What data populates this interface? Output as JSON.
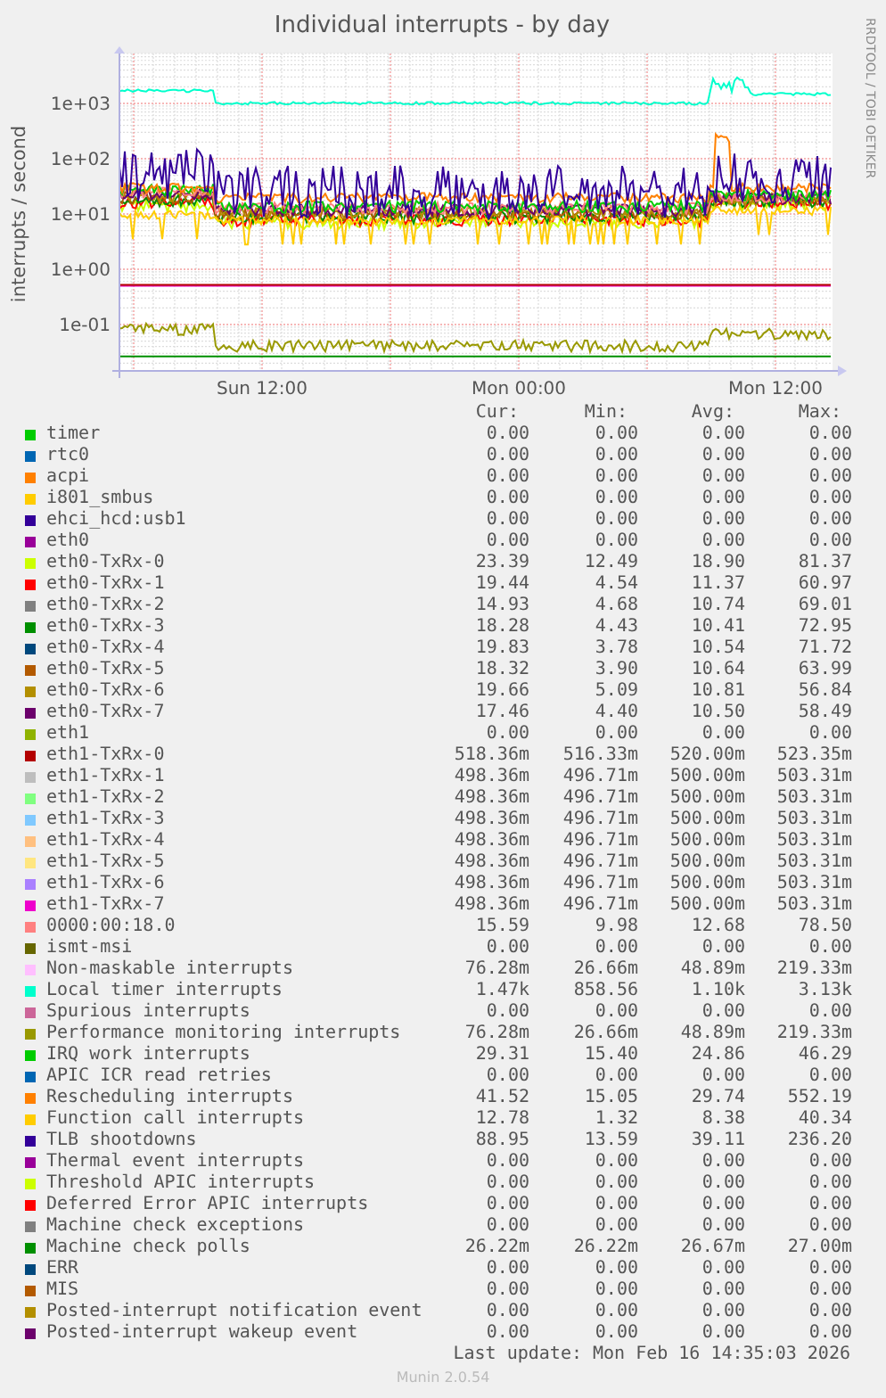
{
  "title": "Individual interrupts - by day",
  "y_axis_label": "interrupts / second",
  "y_ticks": [
    "1e+03",
    "1e+02",
    "1e+01",
    "1e+00",
    "1e-01"
  ],
  "x_ticks": [
    "Sun 12:00",
    "Mon 00:00",
    "Mon 12:00"
  ],
  "credit": "RRDTOOL / TOBI OETIKER",
  "legend": {
    "columns": [
      "Cur:",
      "Min:",
      "Avg:",
      "Max:"
    ],
    "rows": [
      {
        "label": "timer",
        "color": "#00cc00",
        "cur": "0.00",
        "min": "0.00",
        "avg": "0.00",
        "max": "0.00"
      },
      {
        "label": "rtc0",
        "color": "#0066b3",
        "cur": "0.00",
        "min": "0.00",
        "avg": "0.00",
        "max": "0.00"
      },
      {
        "label": "acpi",
        "color": "#ff8000",
        "cur": "0.00",
        "min": "0.00",
        "avg": "0.00",
        "max": "0.00"
      },
      {
        "label": "i801_smbus",
        "color": "#ffcc00",
        "cur": "0.00",
        "min": "0.00",
        "avg": "0.00",
        "max": "0.00"
      },
      {
        "label": "ehci_hcd:usb1",
        "color": "#330099",
        "cur": "0.00",
        "min": "0.00",
        "avg": "0.00",
        "max": "0.00"
      },
      {
        "label": "eth0",
        "color": "#990099",
        "cur": "0.00",
        "min": "0.00",
        "avg": "0.00",
        "max": "0.00"
      },
      {
        "label": "eth0-TxRx-0",
        "color": "#ccff00",
        "cur": "23.39",
        "min": "12.49",
        "avg": "18.90",
        "max": "81.37"
      },
      {
        "label": "eth0-TxRx-1",
        "color": "#ff0000",
        "cur": "19.44",
        "min": "4.54",
        "avg": "11.37",
        "max": "60.97"
      },
      {
        "label": "eth0-TxRx-2",
        "color": "#808080",
        "cur": "14.93",
        "min": "4.68",
        "avg": "10.74",
        "max": "69.01"
      },
      {
        "label": "eth0-TxRx-3",
        "color": "#008f00",
        "cur": "18.28",
        "min": "4.43",
        "avg": "10.41",
        "max": "72.95"
      },
      {
        "label": "eth0-TxRx-4",
        "color": "#00487d",
        "cur": "19.83",
        "min": "3.78",
        "avg": "10.54",
        "max": "71.72"
      },
      {
        "label": "eth0-TxRx-5",
        "color": "#b35a00",
        "cur": "18.32",
        "min": "3.90",
        "avg": "10.64",
        "max": "63.99"
      },
      {
        "label": "eth0-TxRx-6",
        "color": "#b38f00",
        "cur": "19.66",
        "min": "5.09",
        "avg": "10.81",
        "max": "56.84"
      },
      {
        "label": "eth0-TxRx-7",
        "color": "#6b006b",
        "cur": "17.46",
        "min": "4.40",
        "avg": "10.50",
        "max": "58.49"
      },
      {
        "label": "eth1",
        "color": "#8fb300",
        "cur": "0.00",
        "min": "0.00",
        "avg": "0.00",
        "max": "0.00"
      },
      {
        "label": "eth1-TxRx-0",
        "color": "#b30000",
        "cur": "518.36m",
        "min": "516.33m",
        "avg": "520.00m",
        "max": "523.35m"
      },
      {
        "label": "eth1-TxRx-1",
        "color": "#bebebe",
        "cur": "498.36m",
        "min": "496.71m",
        "avg": "500.00m",
        "max": "503.31m"
      },
      {
        "label": "eth1-TxRx-2",
        "color": "#80ff80",
        "cur": "498.36m",
        "min": "496.71m",
        "avg": "500.00m",
        "max": "503.31m"
      },
      {
        "label": "eth1-TxRx-3",
        "color": "#80c9ff",
        "cur": "498.36m",
        "min": "496.71m",
        "avg": "500.00m",
        "max": "503.31m"
      },
      {
        "label": "eth1-TxRx-4",
        "color": "#ffc080",
        "cur": "498.36m",
        "min": "496.71m",
        "avg": "500.00m",
        "max": "503.31m"
      },
      {
        "label": "eth1-TxRx-5",
        "color": "#ffe680",
        "cur": "498.36m",
        "min": "496.71m",
        "avg": "500.00m",
        "max": "503.31m"
      },
      {
        "label": "eth1-TxRx-6",
        "color": "#aa80ff",
        "cur": "498.36m",
        "min": "496.71m",
        "avg": "500.00m",
        "max": "503.31m"
      },
      {
        "label": "eth1-TxRx-7",
        "color": "#ee00cc",
        "cur": "498.36m",
        "min": "496.71m",
        "avg": "500.00m",
        "max": "503.31m"
      },
      {
        "label": "0000:00:18.0",
        "color": "#ff8080",
        "cur": "15.59",
        "min": "9.98",
        "avg": "12.68",
        "max": "78.50"
      },
      {
        "label": "ismt-msi",
        "color": "#666600",
        "cur": "0.00",
        "min": "0.00",
        "avg": "0.00",
        "max": "0.00"
      },
      {
        "label": "Non-maskable interrupts",
        "color": "#ffbfff",
        "cur": "76.28m",
        "min": "26.66m",
        "avg": "48.89m",
        "max": "219.33m"
      },
      {
        "label": "Local timer interrupts",
        "color": "#00ffcc",
        "cur": "1.47k",
        "min": "858.56",
        "avg": "1.10k",
        "max": "3.13k"
      },
      {
        "label": "Spurious interrupts",
        "color": "#cc6699",
        "cur": "0.00",
        "min": "0.00",
        "avg": "0.00",
        "max": "0.00"
      },
      {
        "label": "Performance monitoring interrupts",
        "color": "#999900",
        "cur": "76.28m",
        "min": "26.66m",
        "avg": "48.89m",
        "max": "219.33m"
      },
      {
        "label": "IRQ work interrupts",
        "color": "#00cc00",
        "cur": "29.31",
        "min": "15.40",
        "avg": "24.86",
        "max": "46.29"
      },
      {
        "label": "APIC ICR read retries",
        "color": "#0066b3",
        "cur": "0.00",
        "min": "0.00",
        "avg": "0.00",
        "max": "0.00"
      },
      {
        "label": "Rescheduling interrupts",
        "color": "#ff8000",
        "cur": "41.52",
        "min": "15.05",
        "avg": "29.74",
        "max": "552.19"
      },
      {
        "label": "Function call interrupts",
        "color": "#ffcc00",
        "cur": "12.78",
        "min": "1.32",
        "avg": "8.38",
        "max": "40.34"
      },
      {
        "label": "TLB shootdowns",
        "color": "#330099",
        "cur": "88.95",
        "min": "13.59",
        "avg": "39.11",
        "max": "236.20"
      },
      {
        "label": "Thermal event interrupts",
        "color": "#990099",
        "cur": "0.00",
        "min": "0.00",
        "avg": "0.00",
        "max": "0.00"
      },
      {
        "label": "Threshold APIC interrupts",
        "color": "#ccff00",
        "cur": "0.00",
        "min": "0.00",
        "avg": "0.00",
        "max": "0.00"
      },
      {
        "label": "Deferred Error APIC interrupts",
        "color": "#ff0000",
        "cur": "0.00",
        "min": "0.00",
        "avg": "0.00",
        "max": "0.00"
      },
      {
        "label": "Machine check exceptions",
        "color": "#808080",
        "cur": "0.00",
        "min": "0.00",
        "avg": "0.00",
        "max": "0.00"
      },
      {
        "label": "Machine check polls",
        "color": "#008f00",
        "cur": "26.22m",
        "min": "26.22m",
        "avg": "26.67m",
        "max": "27.00m"
      },
      {
        "label": "ERR",
        "color": "#00487d",
        "cur": "0.00",
        "min": "0.00",
        "avg": "0.00",
        "max": "0.00"
      },
      {
        "label": "MIS",
        "color": "#b35a00",
        "cur": "0.00",
        "min": "0.00",
        "avg": "0.00",
        "max": "0.00"
      },
      {
        "label": "Posted-interrupt notification event",
        "color": "#b38f00",
        "cur": "0.00",
        "min": "0.00",
        "avg": "0.00",
        "max": "0.00"
      },
      {
        "label": "Posted-interrupt wakeup event",
        "color": "#6b006b",
        "cur": "0.00",
        "min": "0.00",
        "avg": "0.00",
        "max": "0.00"
      }
    ]
  },
  "last_update": "Last update: Mon Feb 16 14:35:03 2026",
  "footer": "Munin 2.0.54"
}
